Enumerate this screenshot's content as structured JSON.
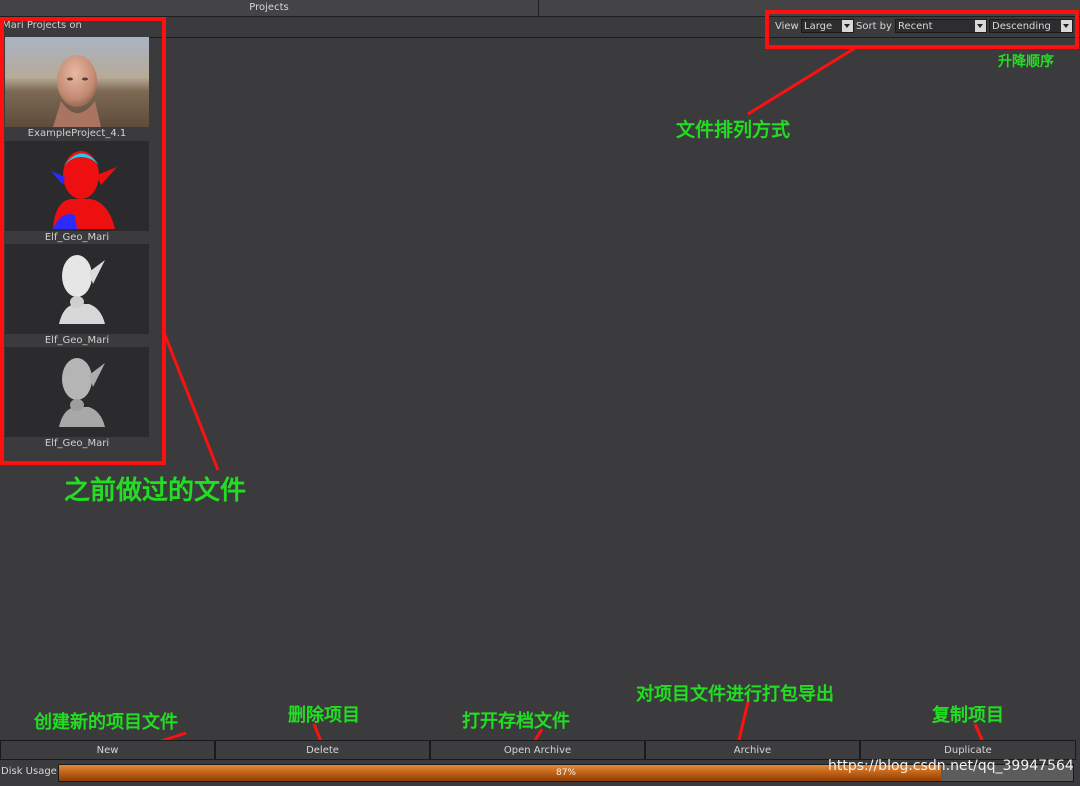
{
  "tabs": {
    "projects": "Projects"
  },
  "list_header": "Mari Projects on",
  "controls": {
    "view_label": "View",
    "view_value": "Large",
    "sort_label": "Sort by",
    "sort_value": "Recent",
    "order_value": "Descending"
  },
  "projects": [
    {
      "name": "ExampleProject_4.1"
    },
    {
      "name": "Elf_Geo_Mari"
    },
    {
      "name": "Elf_Geo_Mari"
    },
    {
      "name": "Elf_Geo_Mari"
    }
  ],
  "buttons": {
    "new": "New",
    "delete": "Delete",
    "open_archive": "Open Archive",
    "archive": "Archive",
    "duplicate": "Duplicate"
  },
  "disk": {
    "label": "Disk Usage",
    "value": 0.87,
    "text": "87%"
  },
  "annotations": {
    "previous_files": "之前做过的文件",
    "sort_method": "文件排列方式",
    "order": "升降顺序",
    "new": "创建新的项目文件",
    "delete": "删除项目",
    "open_archive": "打开存档文件",
    "archive": "对项目文件进行打包导出",
    "duplicate": "复制项目"
  },
  "watermark": "https://blog.csdn.net/qq_39947564",
  "colors": {
    "annotation": "#22dd22",
    "callout": "#ff1010",
    "progress": "#d27a2a"
  }
}
